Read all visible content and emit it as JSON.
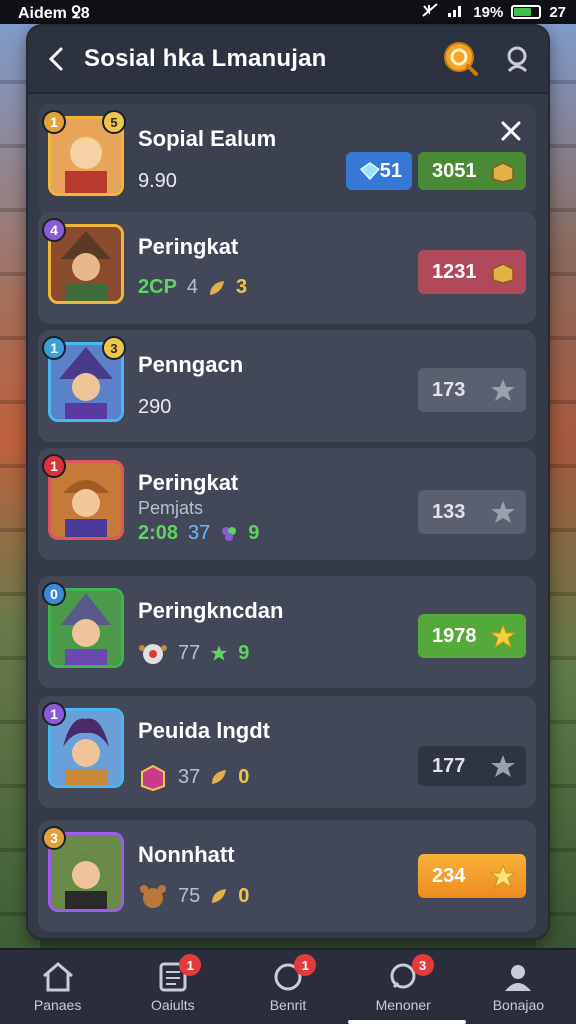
{
  "status_bar": {
    "left_text": "Aidem ꝿ8",
    "battery": "19%",
    "time": "27",
    "battery_level_pct": 70
  },
  "header": {
    "title": "Sosial hka Lmanujan",
    "back_icon": "chevron-left-icon",
    "coin_icon": "coin-icon",
    "search_icon": "search-icon"
  },
  "rows": [
    {
      "name": "Sopial Ealum",
      "rank": "1",
      "level": "5",
      "score": "9.90",
      "gems": "51",
      "coins": "3051"
    },
    {
      "name": "Peringkat",
      "rank": "4",
      "stat_a": "2CP",
      "stat_b": "4",
      "stat_c": "3",
      "coins": "1231"
    },
    {
      "name": "Penngacn",
      "rank": "1",
      "level": "3",
      "score": "290",
      "stars": "173"
    },
    {
      "name": "Peringkat",
      "sub": "Pemjats",
      "rank": "1",
      "stat_a": "2:08",
      "stat_b": "37",
      "stat_c": "9",
      "stars": "133"
    },
    {
      "name": "Peringkncdan",
      "rank": "0",
      "stat_b": "77",
      "stat_c": "9",
      "stars": "1978"
    },
    {
      "name": "Peuida lngdt",
      "rank": "1",
      "stat_b": "37",
      "stat_c": "0",
      "stars": "177"
    },
    {
      "name": "Nonnhatt",
      "rank": "3",
      "stat_b": "75",
      "stat_c": "0",
      "stars": "234"
    }
  ],
  "nav": [
    {
      "label": "Panaes",
      "badge": ""
    },
    {
      "label": "Oaiults",
      "badge": "1"
    },
    {
      "label": "Benrit",
      "badge": "1"
    },
    {
      "label": "Menoner",
      "badge": "3"
    },
    {
      "label": "Bonajao",
      "badge": ""
    }
  ]
}
